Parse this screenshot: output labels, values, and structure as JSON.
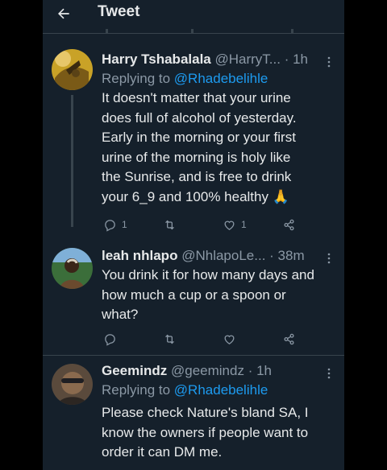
{
  "header": {
    "title": "Tweet",
    "back_icon": "arrow-left-icon"
  },
  "tweets": [
    {
      "name": "Harry Tshabalala",
      "handle": "@HarryT...",
      "time": "· 1h",
      "replying_prefix": "Replying to",
      "replying_to": "@Rhadebelihle",
      "text_lines": [
        "It doesn't matter that your urine",
        "does full of alcohol of yesterday.",
        "Early in the morning or your first",
        "urine of the morning is holy like",
        "the Sunrise, and is free to drink",
        "your 6_9 and 100% healthy 🙏"
      ],
      "reply_count": "1",
      "retweet_count": "",
      "like_count": "1"
    },
    {
      "name": "leah nhlapo",
      "handle": "@NhlapoLe...",
      "time": "· 38m",
      "text_lines": [
        "You drink it for how many days and",
        "how much a cup or a spoon or",
        "what?"
      ],
      "reply_count": "",
      "retweet_count": "",
      "like_count": ""
    },
    {
      "name": "Geemindz",
      "handle": "@geemindz",
      "time": "· 1h",
      "replying_prefix": "Replying to",
      "replying_to": "@Rhadebelihle",
      "text_lines": [
        "Please check Nature's bland SA, I",
        "know the owners if people want to",
        "order it can DM me."
      ]
    }
  ],
  "colors": {
    "background": "#15202b",
    "text": "#e7e9ea",
    "secondary": "#8b98a5",
    "accent": "#1d9bf0",
    "border": "#38444d"
  }
}
